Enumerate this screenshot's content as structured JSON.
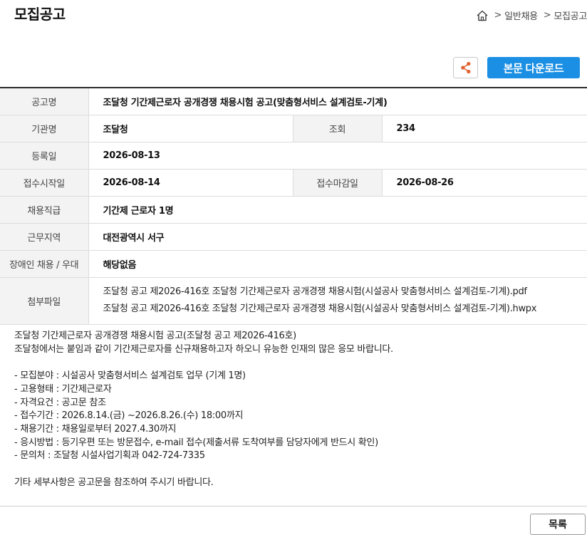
{
  "header": {
    "page_title": "모집공고",
    "breadcrumb": [
      "일반채용",
      "모집공고"
    ]
  },
  "toolbar": {
    "download_label": "본문 다운로드",
    "share_icon": "share-icon",
    "accent_color": "#1a8fe3",
    "share_icon_color": "#e0632f"
  },
  "info": {
    "title_label": "공고명",
    "title_value": "조달청 기간제근로자 공개경쟁 채용시험 공고(맞춤형서비스 설계검토-기계)",
    "org_label": "기관명",
    "org_value": "조달청",
    "views_label": "조회",
    "views_value": "234",
    "reg_date_label": "등록일",
    "reg_date_value": "2026-08-13",
    "start_label": "접수시작일",
    "start_value": "2026-08-14",
    "end_label": "접수마감일",
    "end_value": "2026-08-26",
    "position_label": "채용직급",
    "position_value": "기간제 근로자 1명",
    "location_label": "근무지역",
    "location_value": "대전광역시 서구",
    "disability_label": "장애인 채용 / 우대",
    "disability_value": "해당없음",
    "files_label": "첨부파일",
    "files": [
      "조달청 공고 제2026-416호 조달청 기간제근로자 공개경쟁 채용시험(시설공사 맞춤형서비스 설계검토-기계).pdf",
      "조달청 공고 제2026-416호 조달청 기간제근로자 공개경쟁 채용시험(시설공사 맞춤형서비스 설계검토-기계).hwpx"
    ]
  },
  "body": {
    "lines": [
      "조달청 기간제근로자 공개경쟁 채용시험 공고(조달청 공고 제2026-416호)",
      "조달청에서는 붙임과 같이 기간제근로자를 신규채용하고자 하오니 유능한 인재의 많은 응모 바랍니다.",
      "",
      "- 모집분야 : 시설공사 맞춤형서비스 설계검토 업무 (기계 1명)",
      "- 고용형태 : 기간제근로자",
      "- 자격요건 : 공고문 참조",
      "- 접수기간 : 2026.8.14.(금) ~2026.8.26.(수) 18:00까지",
      "- 채용기간 : 채용일로부터 2027.4.30까지",
      "- 응시방법 : 등기우편 또는 방문접수, e-mail 접수(제출서류 도착여부를 담당자에게 반드시 확인)",
      "- 문의처 : 조달청 시설사업기획과 042-724-7335",
      "",
      "기타 세부사항은 공고문을 참조하여 주시기 바랍니다."
    ]
  },
  "footer": {
    "list_label": "목록"
  }
}
